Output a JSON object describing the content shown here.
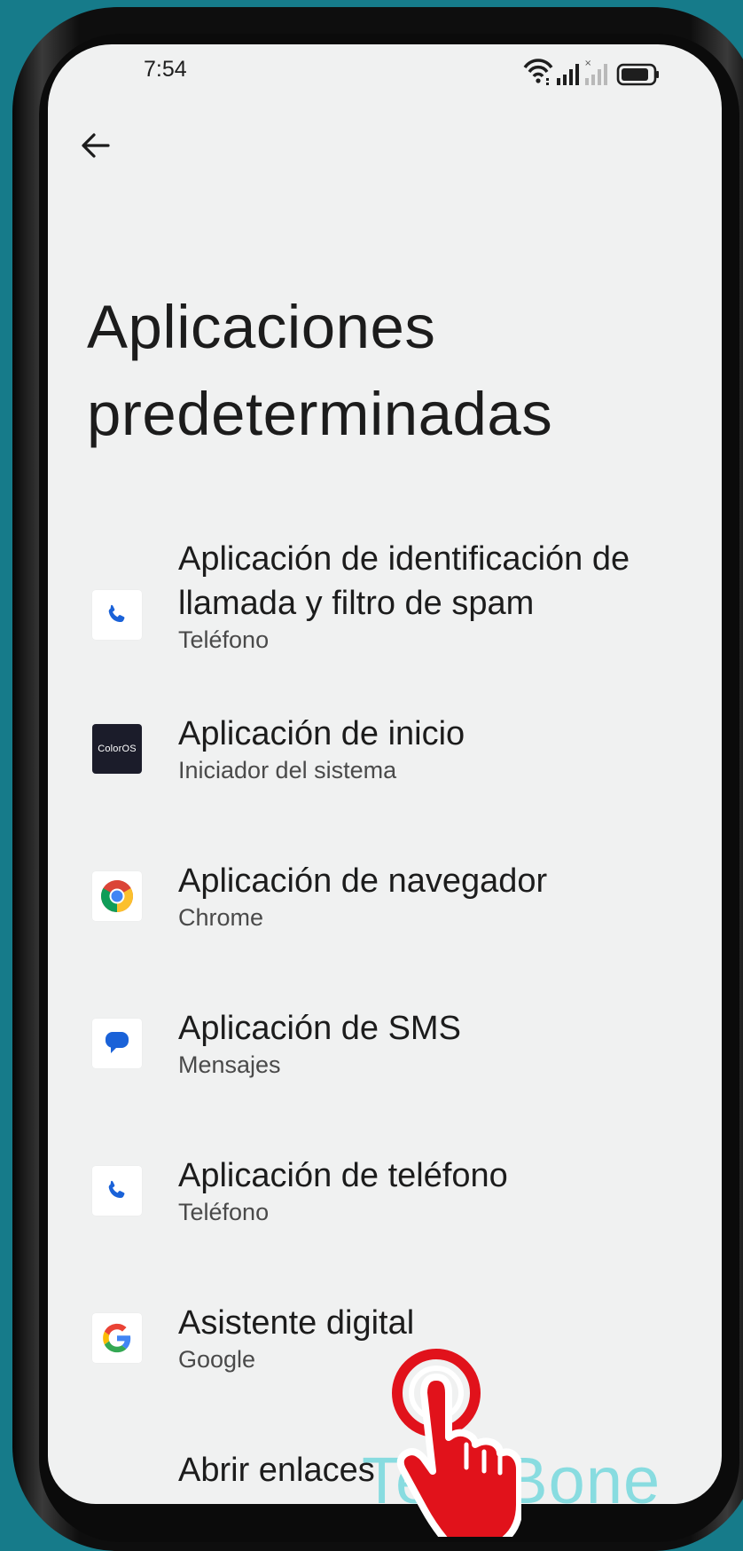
{
  "status_bar": {
    "time": "7:54"
  },
  "page": {
    "title": "Aplicaciones predeterminadas"
  },
  "items": [
    {
      "title": "Aplicación de identificación de llamada y filtro de spam",
      "subtitle": "Teléfono",
      "icon": "phone-icon"
    },
    {
      "title": "Aplicación de inicio",
      "subtitle": "Iniciador del sistema",
      "icon": "coloros-icon",
      "icon_text": "ColorOS"
    },
    {
      "title": "Aplicación de navegador",
      "subtitle": "Chrome",
      "icon": "chrome-icon"
    },
    {
      "title": "Aplicación de SMS",
      "subtitle": "Mensajes",
      "icon": "messages-icon"
    },
    {
      "title": "Aplicación de teléfono",
      "subtitle": "Teléfono",
      "icon": "phone-icon"
    },
    {
      "title": "Asistente digital",
      "subtitle": "Google",
      "icon": "google-icon"
    },
    {
      "title": "Abrir enlaces"
    }
  ],
  "overlay": {
    "watermark": "TechBone",
    "gesture": "tap-hand-icon"
  },
  "colors": {
    "background": "#167b8a",
    "screen": "#f0f1f1",
    "accent_blue": "#1a62d8",
    "hand_red": "#e1121b",
    "watermark": "#6fd7dc"
  }
}
